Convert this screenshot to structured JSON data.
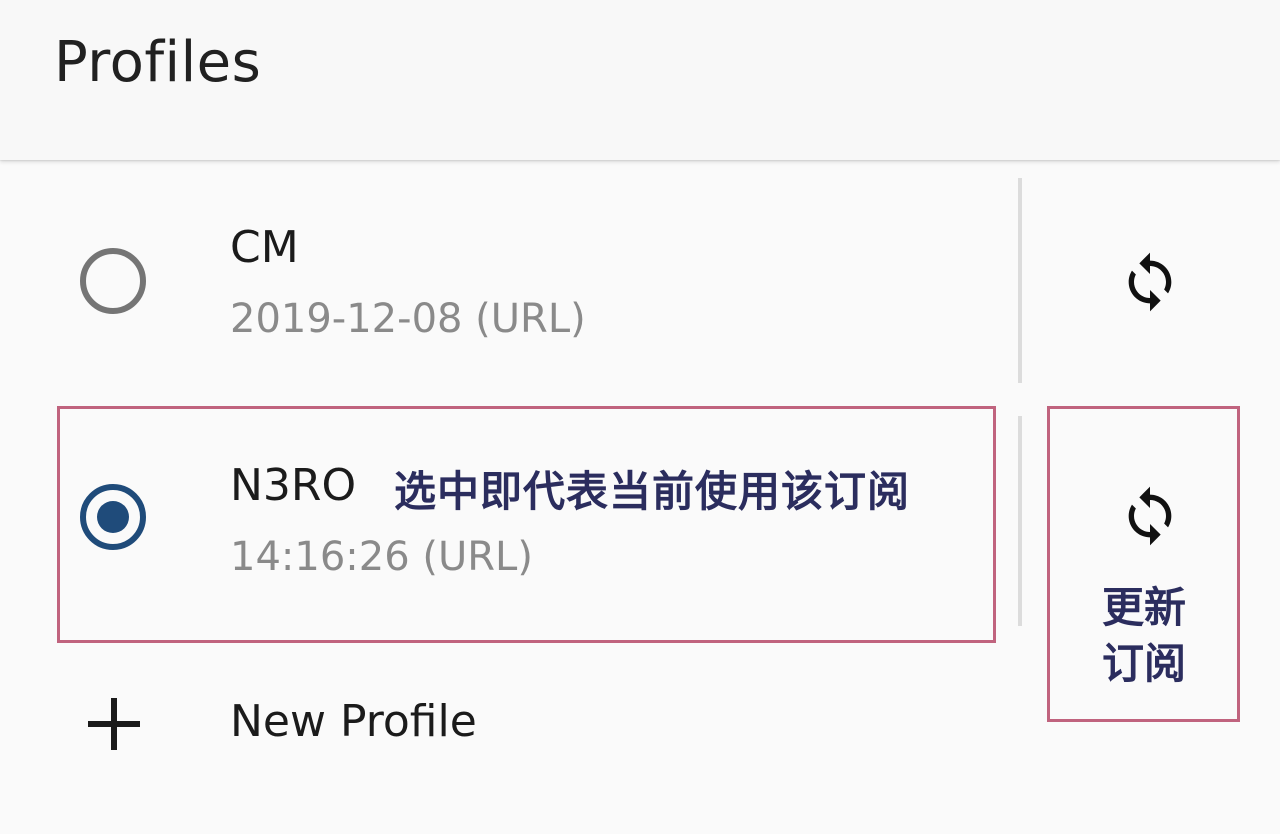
{
  "appbar": {
    "title": "Profiles"
  },
  "profiles": [
    {
      "name": "CM",
      "subtitle": "2019-12-08 (URL)",
      "selected": false,
      "refresh_icon": "sync-icon"
    },
    {
      "name": "N3RO",
      "subtitle": "14:16:26 (URL)",
      "selected": true,
      "refresh_icon": "sync-icon"
    }
  ],
  "new_profile": {
    "label": "New Profile",
    "icon": "plus-icon"
  },
  "annotations": {
    "select_note": "选中即代表当前使用该订阅",
    "update_note_line1": "更新",
    "update_note_line2": "订阅",
    "border_color": "#c0637e",
    "text_color": "#2b2d5e"
  },
  "colors": {
    "accent": "#1f4b7a",
    "background": "#fafafa",
    "secondary_text": "#8a8a8a"
  }
}
